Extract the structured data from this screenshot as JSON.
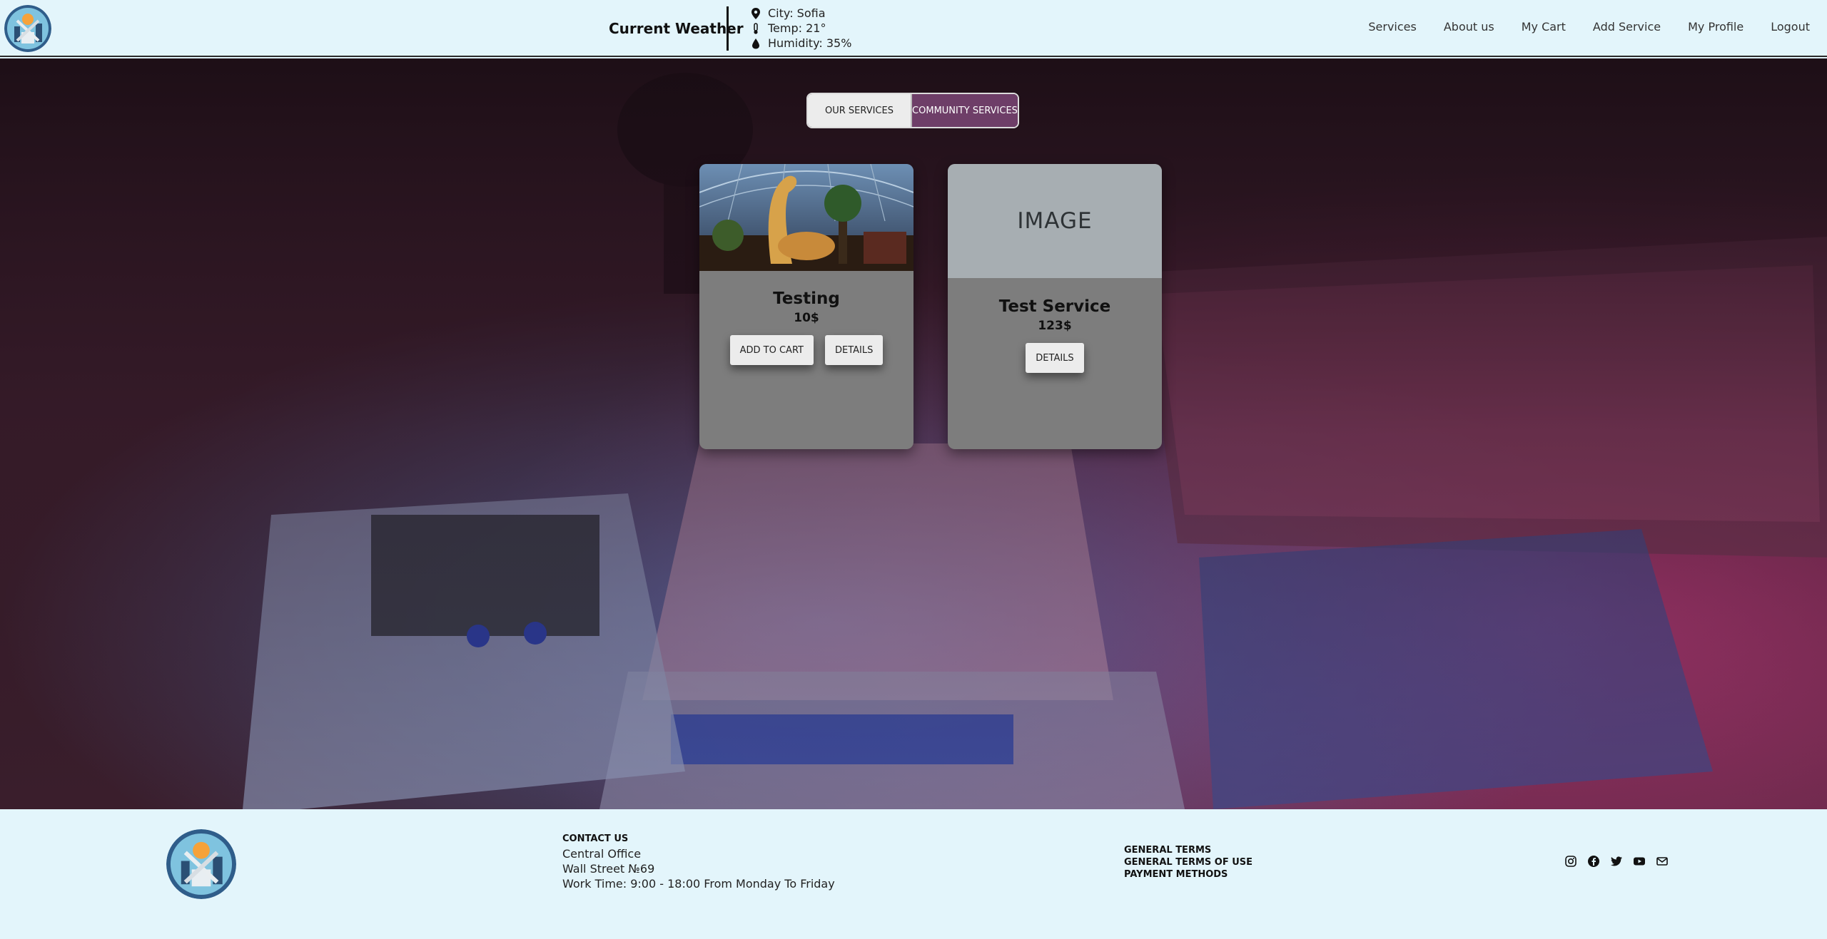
{
  "header": {
    "weather_title": "Current Weather",
    "weather": {
      "city": "City: Sofia",
      "temp": "Temp: 21°",
      "humidity": "Humidity: 35%"
    },
    "nav": [
      "Services",
      "About us",
      "My Cart",
      "Add Service",
      "My Profile",
      "Logout"
    ]
  },
  "tabs": {
    "ours": "OUR SERVICES",
    "community": "COMMUNITY SERVICES"
  },
  "cards": [
    {
      "title": "Testing",
      "price": "10$",
      "add_to_cart": "ADD TO CART",
      "details": "DETAILS"
    },
    {
      "image_placeholder": "IMAGE",
      "title": "Test Service",
      "price": "123$",
      "details": "DETAILS"
    }
  ],
  "footer": {
    "contact_heading": "CONTACT US",
    "contact_lines": [
      "Central Office",
      "Wall Street №69",
      "Work Time: 9:00 - 18:00 From Monday To Friday"
    ],
    "terms": [
      "GENERAL TERMS",
      "GENERAL TERMS OF USE",
      "PAYMENT METHODS"
    ],
    "socials": [
      "instagram-icon",
      "facebook-icon",
      "twitter-icon",
      "youtube-icon",
      "email-icon"
    ]
  },
  "colors": {
    "header_bg": "#e3f5fb",
    "tab_active": "#6e3e68",
    "card_bg": "#7d7d7d"
  }
}
